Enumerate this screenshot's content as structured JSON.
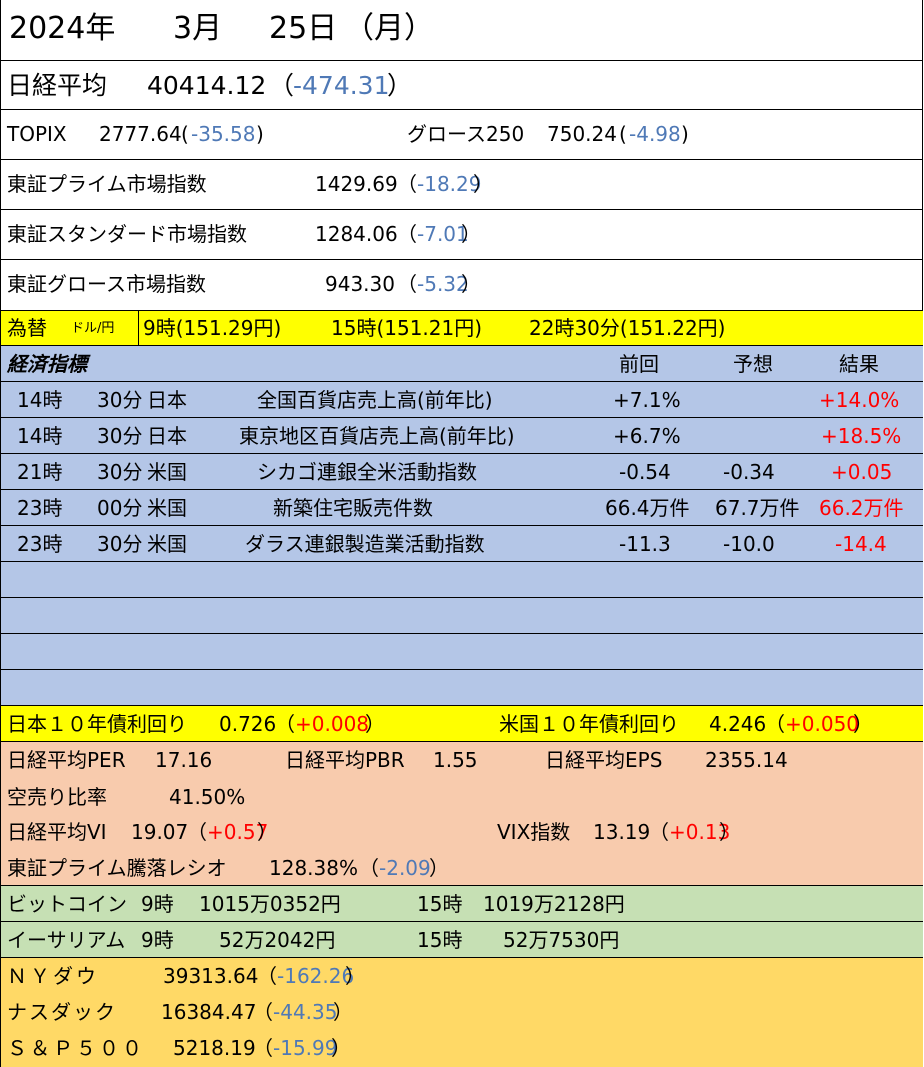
{
  "date": {
    "year": "2024年",
    "month": "3月",
    "day": "25日",
    "weekday": "（月）"
  },
  "nikkei": {
    "label": "日経平均",
    "value": "40414.12",
    "open": "（",
    "change": "-474.31",
    "close": "）"
  },
  "topix": {
    "label": "TOPIX",
    "value": "2777.64",
    "open": "(",
    "change": "-35.58",
    "close": ")"
  },
  "growth250": {
    "label": "グロース250",
    "value": "750.24",
    "open": "(",
    "change": "-4.98",
    "close": ")"
  },
  "prime": {
    "label": "東証プライム市場指数",
    "value": "1429.69",
    "open": "（",
    "change": "-18.29",
    "close": "）"
  },
  "standard": {
    "label": "東証スタンダード市場指数",
    "value": "1284.06",
    "open": "（",
    "change": "-7.01",
    "close": "）"
  },
  "growth_index": {
    "label": "東証グロース市場指数",
    "value": "943.30",
    "open": "（",
    "change": "-5.32",
    "close": "）"
  },
  "fx": {
    "label": "為替",
    "sub": "ドル/円",
    "t1": "9時(151.29円)",
    "t2": "15時(151.21円)",
    "t3": "22時30分(151.22円)"
  },
  "econ": {
    "title": "経済指標",
    "h_prev": "前回",
    "h_fcst": "予想",
    "h_result": "結果",
    "rows": [
      {
        "hour": "14時",
        "min": "30分",
        "country": "日本",
        "name": "全国百貨店売上高(前年比)",
        "prev": "+7.1%",
        "fcst": "",
        "result": "+14.0%"
      },
      {
        "hour": "14時",
        "min": "30分",
        "country": "日本",
        "name": "東京地区百貨店売上高(前年比)",
        "prev": "+6.7%",
        "fcst": "",
        "result": "+18.5%"
      },
      {
        "hour": "21時",
        "min": "30分",
        "country": "米国",
        "name": "シカゴ連銀全米活動指数",
        "prev": "-0.54",
        "fcst": "-0.34",
        "result": "+0.05"
      },
      {
        "hour": "23時",
        "min": "00分",
        "country": "米国",
        "name": "新築住宅販売件数",
        "prev": "66.4万件",
        "fcst": "67.7万件",
        "result": "66.2万件"
      },
      {
        "hour": "23時",
        "min": "30分",
        "country": "米国",
        "name": "ダラス連銀製造業活動指数",
        "prev": "-11.3",
        "fcst": "-10.0",
        "result": "-14.4"
      }
    ]
  },
  "bonds": {
    "jp_label": "日本１０年債利回り",
    "jp_value": "0.726",
    "jp_open": "（",
    "jp_change": "+0.008",
    "jp_close": "）",
    "us_label": "米国１０年債利回り",
    "us_value": "4.246",
    "us_open": "（",
    "us_change": "+0.050",
    "us_close": "）"
  },
  "valuation": {
    "per_label": "日経平均PER",
    "per": "17.16",
    "pbr_label": "日経平均PBR",
    "pbr": "1.55",
    "eps_label": "日経平均EPS",
    "eps": "2355.14",
    "short_label": "空売り比率",
    "short": "41.50%",
    "vi_label": "日経平均VI",
    "vi": "19.07",
    "vi_open": "（",
    "vi_change": "+0.57",
    "vi_close": "）",
    "vix_label": "VIX指数",
    "vix": "13.19",
    "vix_open": "（",
    "vix_change": "+0.13",
    "vix_close": "）",
    "adr_label": "東証プライム騰落レシオ",
    "adr": "128.38%",
    "adr_open": "（",
    "adr_change": "-2.09",
    "adr_close": "）"
  },
  "crypto": {
    "btc_label": "ビットコイン",
    "btc_t1": "9時",
    "btc_v1": "1015万0352円",
    "btc_t2": "15時",
    "btc_v2": "1019万2128円",
    "eth_label": "イーサリアム",
    "eth_t1": "9時",
    "eth_v1": "52万2042円",
    "eth_t2": "15時",
    "eth_v2": "52万7530円"
  },
  "us": {
    "dow_label": "ＮＹダウ",
    "dow": "39313.64",
    "dow_open": "（",
    "dow_change": "-162.26",
    "dow_close": "）",
    "nasdaq_label": "ナスダック",
    "nasdaq": "16384.47",
    "nasdaq_open": "（",
    "nasdaq_change": "-44.35",
    "nasdaq_close": "）",
    "sp_label": "Ｓ＆Ｐ５００",
    "sp": "5218.19",
    "sp_open": "（",
    "sp_change": "-15.99",
    "sp_close": "）"
  },
  "colors": {
    "negative": "#4f79b6",
    "positive": "#ff0000",
    "yellow": "#ffff00",
    "blue": "#b4c6e7",
    "peach": "#f8cbad",
    "green": "#c6e0b4",
    "orange": "#ffd966"
  }
}
